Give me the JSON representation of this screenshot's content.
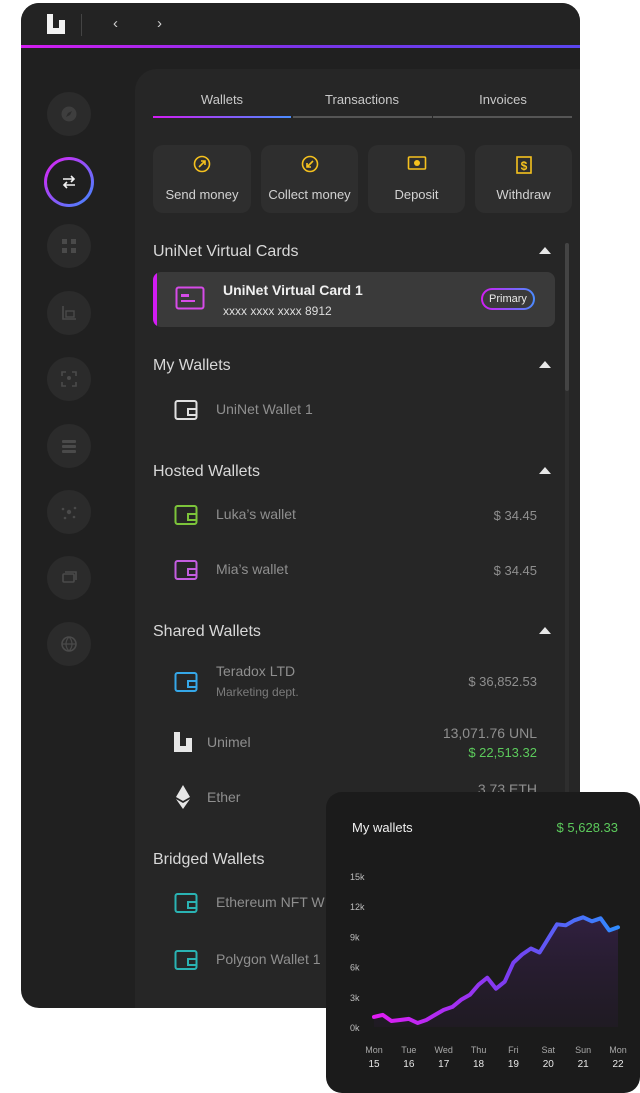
{
  "titlebar": {
    "logo_icon": "unimel-logo-icon",
    "back_label": "‹",
    "forward_label": "›"
  },
  "accent_colors": {
    "magenta": "#d21cf3",
    "blue": "#4a8cff",
    "green": "#5ccb5c"
  },
  "sidebar": {
    "items": [
      {
        "name": "compass-icon",
        "active": false
      },
      {
        "name": "transfer-icon",
        "active": true
      },
      {
        "name": "network-icon",
        "active": false
      },
      {
        "name": "chart-icon",
        "active": false
      },
      {
        "name": "scan-icon",
        "active": false
      },
      {
        "name": "layers-icon",
        "active": false
      },
      {
        "name": "nodes-icon",
        "active": false
      },
      {
        "name": "chat-icon",
        "active": false
      },
      {
        "name": "globe-icon",
        "active": false
      }
    ]
  },
  "tabs": [
    {
      "label": "Wallets",
      "active": true
    },
    {
      "label": "Transactions",
      "active": false
    },
    {
      "label": "Invoices",
      "active": false
    }
  ],
  "actions": [
    {
      "label": "Send money",
      "icon": "arrow-up-right-icon"
    },
    {
      "label": "Collect money",
      "icon": "arrow-down-left-icon"
    },
    {
      "label": "Deposit",
      "icon": "cash-icon"
    },
    {
      "label": "Withdraw",
      "icon": "dollar-receipt-icon"
    }
  ],
  "sections": {
    "virtual_cards": {
      "title": "UniNet Virtual Cards"
    },
    "my_wallets": {
      "title": "My Wallets"
    },
    "hosted_wallets": {
      "title": "Hosted Wallets"
    },
    "shared_wallets": {
      "title": "Shared Wallets"
    },
    "bridged_wallets": {
      "title": "Bridged Wallets"
    }
  },
  "virtual_card": {
    "title": "UniNet Virtual Card 1",
    "number": "xxxx xxxx xxxx 8912",
    "badge": "Primary"
  },
  "my_wallets": [
    {
      "label": "UniNet Wallet 1"
    }
  ],
  "hosted_wallets": [
    {
      "label": "Luka’s wallet",
      "amount": "$ 34.45",
      "color": "#7cc43a"
    },
    {
      "label": "Mia’s wallet",
      "amount": "$ 34.45",
      "color": "#c45de0"
    }
  ],
  "shared_wallets": [
    {
      "label": "Teradox LTD",
      "sub": "Marketing dept.",
      "amount": "$ 36,852.53"
    },
    {
      "label": "Unimel",
      "amount": "13,071.76 UNL",
      "amount2": "$ 22,513.32"
    },
    {
      "label": "Ether",
      "amount": "3.73 ETH"
    }
  ],
  "bridged_wallets": [
    {
      "label": "Ethereum NFT W"
    },
    {
      "label": "Polygon Wallet 1"
    }
  ],
  "popup": {
    "title": "My wallets",
    "total": "$ 5,628.33"
  },
  "chart_data": {
    "type": "line",
    "categories": [
      "Mon 15",
      "Tue 16",
      "Wed 17",
      "Thu 18",
      "Fri 19",
      "Sat 20",
      "Sun 21",
      "Mon 22"
    ],
    "x_day_labels": [
      "Mon",
      "Tue",
      "Wed",
      "Thu",
      "Fri",
      "Sat",
      "Sun",
      "Mon"
    ],
    "x_date_labels": [
      "15",
      "16",
      "17",
      "18",
      "19",
      "20",
      "21",
      "22"
    ],
    "y_ticks": [
      "0k",
      "3k",
      "6k",
      "9k",
      "12k",
      "15k"
    ],
    "ylim": [
      0,
      15000
    ],
    "grid": false,
    "series": [
      {
        "x": [
          0,
          0.25,
          0.5,
          0.75,
          1,
          1.25,
          1.5,
          1.75,
          2,
          2.25,
          2.5,
          2.75,
          3,
          3.25,
          3.5,
          3.75,
          4,
          4.25,
          4.5,
          4.75,
          5,
          5.25,
          5.5,
          5.75,
          6,
          6.25,
          6.5,
          6.75,
          7
        ],
        "values": [
          1000,
          1200,
          600,
          700,
          800,
          400,
          700,
          1200,
          1700,
          2000,
          2700,
          3200,
          4200,
          4900,
          3800,
          4500,
          6400,
          7200,
          7800,
          7400,
          8800,
          10200,
          10100,
          10600,
          10900,
          10500,
          10800,
          9600,
          9900
        ]
      }
    ]
  }
}
